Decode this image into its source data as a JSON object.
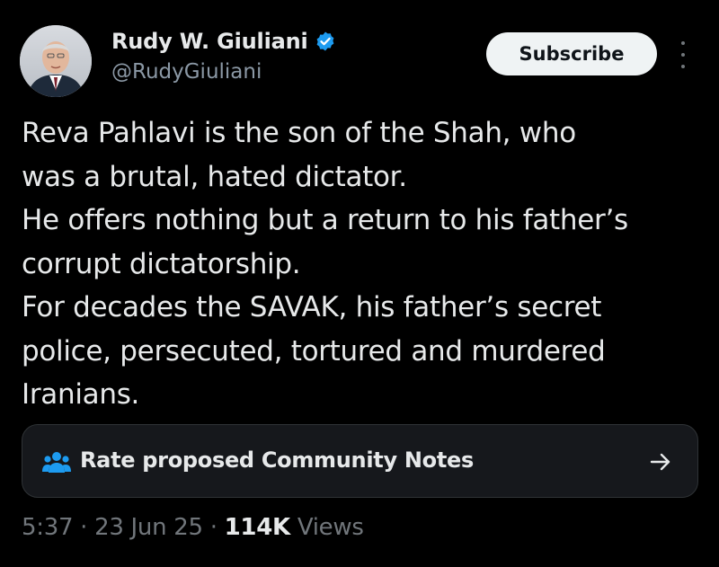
{
  "author": {
    "display_name": "Rudy W. Giuliani",
    "handle": "@RudyGiuliani",
    "verified": true
  },
  "actions": {
    "subscribe_label": "Subscribe",
    "more_icon": "more-vertical-icon"
  },
  "tweet": {
    "lines": [
      "Reva Pahlavi is the son of the Shah, who",
      "was a brutal, hated dictator.",
      "He offers nothing but a return to his father’s",
      "corrupt dictatorship.",
      "For decades the SAVAK, his father’s secret",
      "police, persecuted, tortured and murdered",
      "Iranians."
    ]
  },
  "community_notes": {
    "label": "Rate proposed Community Notes",
    "icon": "people-icon",
    "arrow_icon": "arrow-right-icon"
  },
  "meta": {
    "time": "5:37",
    "separator": "·",
    "date": "23 Jun 25",
    "views_count": "114K",
    "views_label": "Views"
  },
  "colors": {
    "background": "#000000",
    "text_primary": "#e7e9ea",
    "text_secondary": "#71767b",
    "verified_blue": "#1d9bf0",
    "accent_notes": "#1d9bf0"
  }
}
